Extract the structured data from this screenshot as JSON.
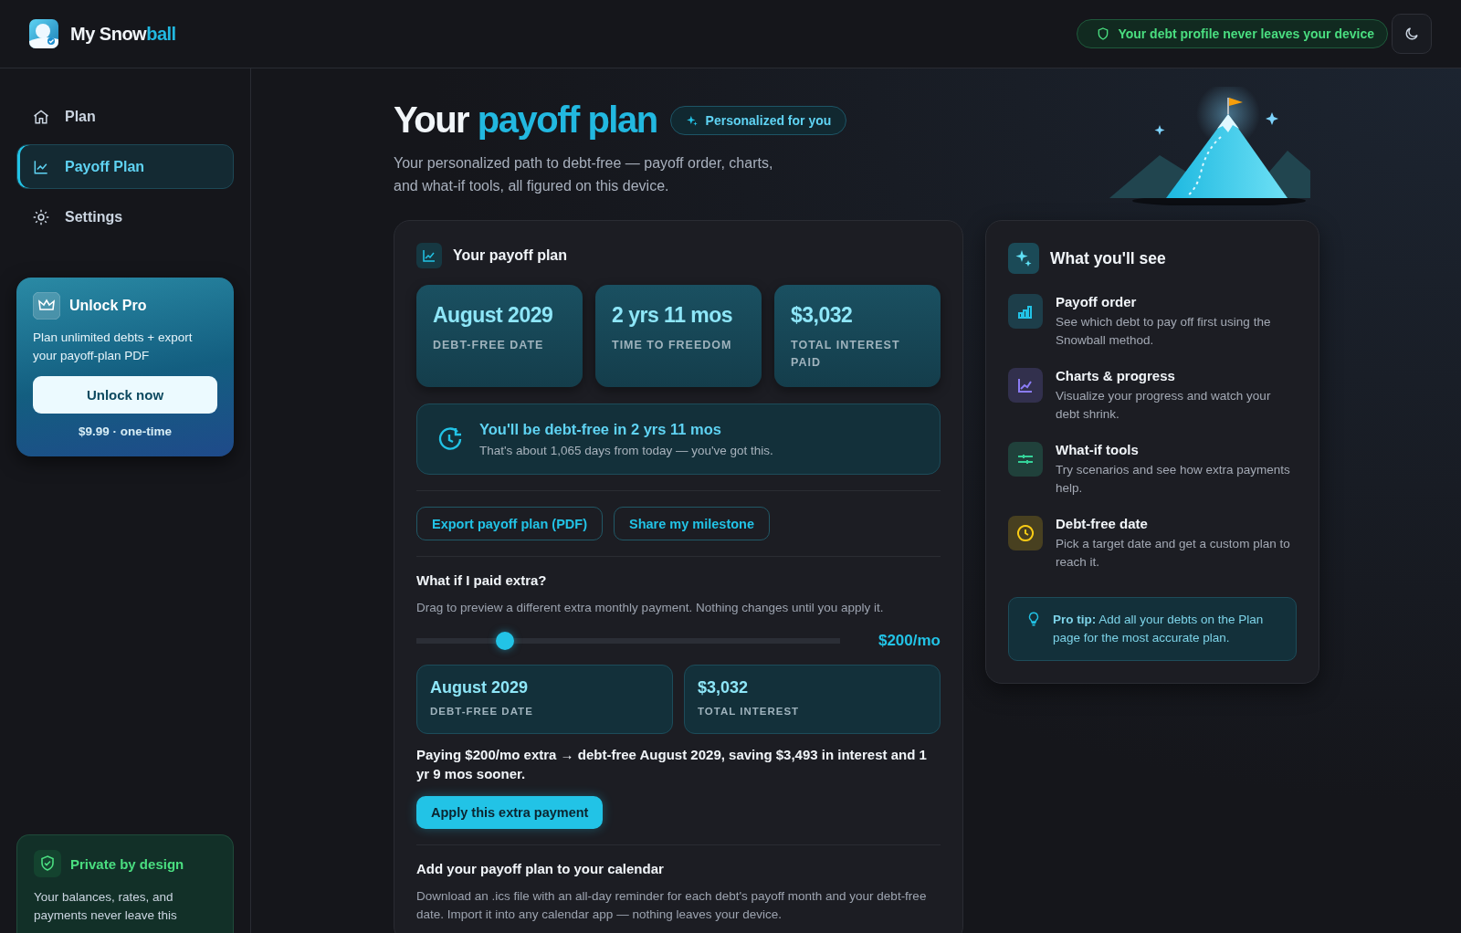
{
  "brand": {
    "lead": "My Snow",
    "highlight": "ball"
  },
  "privacy_badge": "Your debt profile never leaves your device",
  "sidebar": {
    "items": [
      {
        "label": "Plan",
        "selected": false
      },
      {
        "label": "Payoff Plan",
        "selected": true
      },
      {
        "label": "Settings",
        "selected": false
      }
    ],
    "pro_card": {
      "title": "Unlock Pro",
      "text": "Plan unlimited debts + export your payoff-plan PDF",
      "button": "Unlock now",
      "price": "$9.99 · one-time"
    },
    "private_card": {
      "title": "Private by design",
      "text": "Your balances, rates, and payments never leave this"
    }
  },
  "header": {
    "title_lead": "Your",
    "title_highlight": "payoff plan",
    "badge": "Personalized for you",
    "subtitle": "Your personalized path to debt-free — payoff order, charts, and what-if tools, all figured on this device."
  },
  "plan_card": {
    "title": "Your payoff plan",
    "stats": [
      {
        "value": "August 2029",
        "label": "DEBT-FREE DATE"
      },
      {
        "value": "2 yrs 11 mos",
        "label": "TIME TO FREEDOM"
      },
      {
        "value": "$3,032",
        "label": "TOTAL INTEREST PAID"
      }
    ],
    "banner": {
      "title": "You'll be debt-free in 2 yrs 11 mos",
      "text": "That's about 1,065 days from today — you've got this."
    },
    "actions": [
      "Export payoff plan (PDF)",
      "Share my milestone"
    ],
    "what_if": {
      "title": "What if I paid extra?",
      "text": "Drag to preview a different extra monthly payment. Nothing changes until you apply it.",
      "slider": {
        "level": 0.21
      },
      "reading": "$200/mo",
      "results": [
        {
          "value": "August 2029",
          "label": "DEBT-FREE DATE"
        },
        {
          "value": "$3,032",
          "label": "TOTAL INTEREST"
        }
      ],
      "summary": "Paying $200/mo extra → debt-free August 2029, saving $3,493 in interest and 1 yr 9 mos sooner.",
      "button": "Apply this extra payment"
    },
    "calendar": {
      "title": "Add your payoff plan to your calendar",
      "text": "Download an .ics file with an all-day reminder for each debt's payoff month and your debt-free date. Import it into any calendar app — nothing leaves your device."
    }
  },
  "features_card": {
    "title": "What you'll see",
    "items": [
      {
        "title": "Payoff order",
        "text": "See which debt to pay off first using the Snowball method.",
        "color": "#22c3e6"
      },
      {
        "title": "Charts & progress",
        "text": "Visualize your progress and watch your debt shrink.",
        "color": "#8b7cf6"
      },
      {
        "title": "What-if tools",
        "text": "Try scenarios and see how extra payments help.",
        "color": "#34d399"
      },
      {
        "title": "Debt-free date",
        "text": "Pick a target date and get a custom plan to reach it.",
        "color": "#facc15"
      }
    ],
    "tip": "**Pro tip:** Add all your debts on the Plan page for the most accurate plan."
  }
}
